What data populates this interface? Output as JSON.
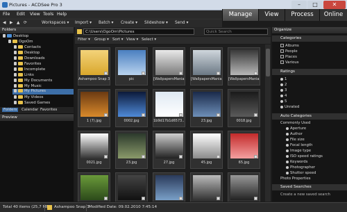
{
  "window": {
    "title": "Pictures - ACDSee Pro 3"
  },
  "menu": [
    "File",
    "Edit",
    "View",
    "Tools",
    "Help"
  ],
  "modes": [
    {
      "label": "Manage",
      "active": true
    },
    {
      "label": "View"
    },
    {
      "label": "Process"
    },
    {
      "label": "Online"
    }
  ],
  "toolbar": [
    "Workspaces ▾",
    "Import ▾",
    "Batch ▾",
    "Create ▾",
    "Slideshow ▾",
    "Send ▾"
  ],
  "folders": {
    "header": "Folders",
    "items": [
      "Desktop",
      "OgoOm",
      "Contacts",
      "Desktop",
      "Downloads",
      "Favorites",
      "Incomplete",
      "Links",
      "My Documents",
      "My Music",
      "My Pictures",
      "My Videos",
      "Saved Games"
    ],
    "tabs": [
      "Folders",
      "Calendar",
      "Favorites"
    ]
  },
  "preview": {
    "header": "Preview"
  },
  "address": {
    "path": "C:\\Users\\OgoOm\\Pictures",
    "search_placeholder": "Quick Search"
  },
  "filterbar": [
    "Filter ▾",
    "Group ▾",
    "Sort ▾",
    "View ▾",
    "Select ▾"
  ],
  "tiles": [
    "Ashampoo Snap 3",
    "pic",
    "[WallpapersMania]_...",
    "[WallpapersMania]_...",
    "[WallpapersMania]_...",
    "1 (7).jpg",
    "0002.jpg",
    "1b9d17b1d6573...",
    "23.jpg",
    "0018.jpg",
    "0021.jpg",
    "23.jpg",
    "27.jpg",
    "45.jpg",
    "65.jpg",
    "",
    "",
    "",
    "",
    ""
  ],
  "organize": {
    "header": "Organize",
    "categories": {
      "title": "Categories",
      "items": [
        "Albums",
        "People",
        "Places",
        "Various"
      ]
    },
    "ratings": {
      "title": "Ratings",
      "items": [
        "1",
        "2",
        "3",
        "4",
        "5",
        "Unrated"
      ]
    },
    "auto": {
      "title": "Auto Categories",
      "group": "Commonly Used",
      "items": [
        "Aperture",
        "Author",
        "File size",
        "Focal length",
        "Image type",
        "ISO speed ratings",
        "Keywords",
        "Photographer",
        "Shutter speed"
      ],
      "extra": "Photo Properties"
    },
    "saved": {
      "title": "Saved Searches",
      "create": "Create a new saved search"
    }
  },
  "status": {
    "total": "Total 40 items (25,7 MB)",
    "selected": "Ashampoo Snap 3",
    "modified": "Modified Date: 09.02.2010 7:45:14"
  }
}
